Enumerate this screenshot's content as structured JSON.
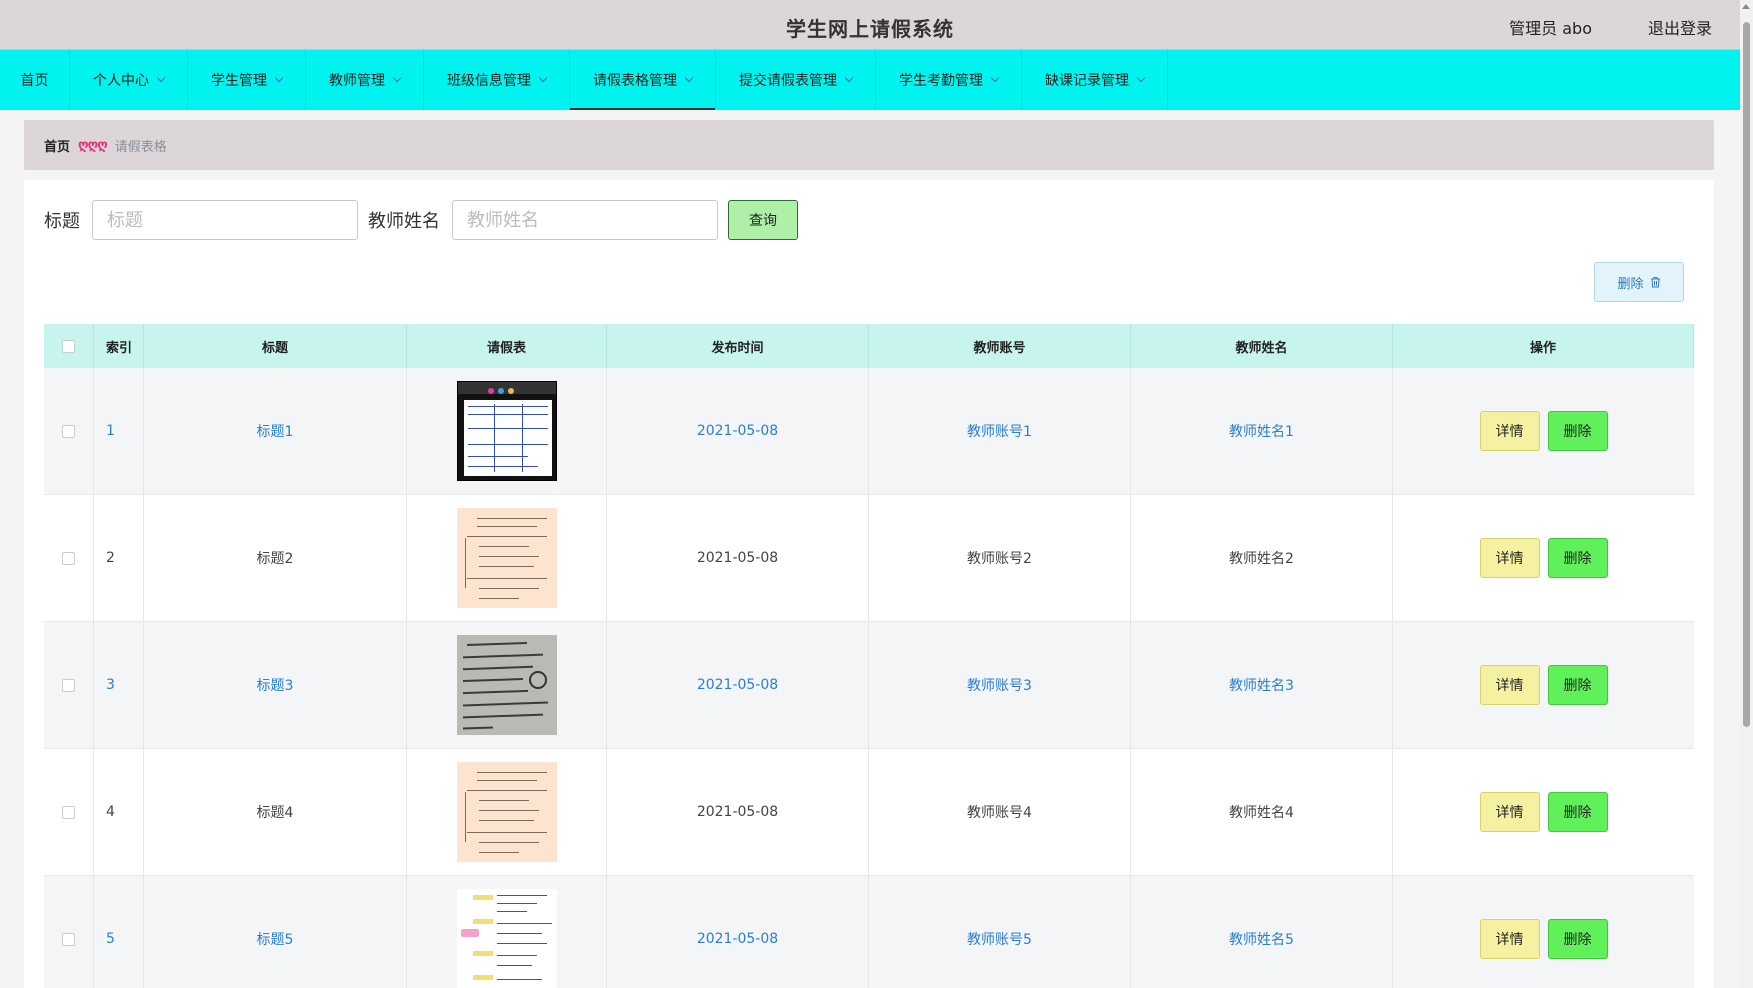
{
  "header": {
    "title": "学生网上请假系统",
    "admin": "管理员 abo",
    "logout": "退出登录"
  },
  "nav": {
    "items": [
      {
        "label": "首页",
        "dropdown": false,
        "active": false
      },
      {
        "label": "个人中心",
        "dropdown": true,
        "active": false
      },
      {
        "label": "学生管理",
        "dropdown": true,
        "active": false
      },
      {
        "label": "教师管理",
        "dropdown": true,
        "active": false
      },
      {
        "label": "班级信息管理",
        "dropdown": true,
        "active": false
      },
      {
        "label": "请假表格管理",
        "dropdown": true,
        "active": true
      },
      {
        "label": "提交请假表管理",
        "dropdown": true,
        "active": false
      },
      {
        "label": "学生考勤管理",
        "dropdown": true,
        "active": false
      },
      {
        "label": "缺课记录管理",
        "dropdown": true,
        "active": false
      }
    ]
  },
  "breadcrumb": {
    "home": "首页",
    "separator": "ღღღ",
    "current": "请假表格"
  },
  "search": {
    "title_label": "标题",
    "title_placeholder": "标题",
    "teacher_label": "教师姓名",
    "teacher_placeholder": "教师姓名",
    "query_button": "查询"
  },
  "toolbar": {
    "delete_label": "删除"
  },
  "table": {
    "headers": {
      "index": "索引",
      "title": "标题",
      "form": "请假表",
      "time": "发布时间",
      "account": "教师账号",
      "name": "教师姓名",
      "ops": "操作"
    },
    "rows": [
      {
        "index": "1",
        "title": "标题1",
        "time": "2021-05-08",
        "account": "教师账号1",
        "name": "教师姓名1",
        "highlight": true,
        "thumb": "worksheet-photo"
      },
      {
        "index": "2",
        "title": "标题2",
        "time": "2021-05-08",
        "account": "教师账号2",
        "name": "教师姓名2",
        "highlight": false,
        "thumb": "peach-document"
      },
      {
        "index": "3",
        "title": "标题3",
        "time": "2021-05-08",
        "account": "教师账号3",
        "name": "教师姓名3",
        "highlight": true,
        "thumb": "handwritten-note"
      },
      {
        "index": "4",
        "title": "标题4",
        "time": "2021-05-08",
        "account": "教师账号4",
        "name": "教师姓名4",
        "highlight": false,
        "thumb": "peach-document"
      },
      {
        "index": "5",
        "title": "标题5",
        "time": "2021-05-08",
        "account": "教师账号5",
        "name": "教师姓名5",
        "highlight": true,
        "thumb": "mind-map"
      }
    ],
    "detail_label": "详情",
    "delete_label": "删除"
  },
  "colors": {
    "nav_bg": "#00f3ee",
    "header_bg": "#ddd6d8",
    "table_head_bg": "#c7f5ee",
    "link_blue": "#2a7ed8",
    "detail_btn": "#f4f2a0",
    "delete_btn": "#5ff05a"
  }
}
